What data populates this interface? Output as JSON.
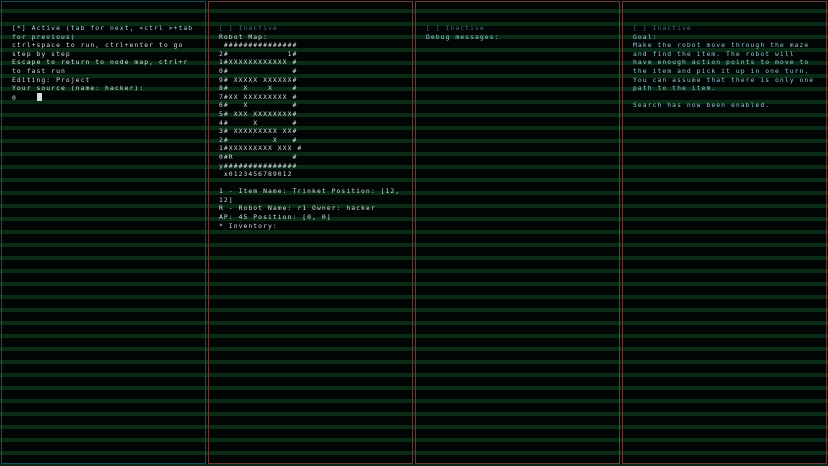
{
  "panels": {
    "editor": {
      "header": "[*] Active (tab for next, <ctrl >+tab for previous)",
      "lines": [
        "ctrl+space to run, ctrl+enter to go step by step",
        "Escape to return to node map, ctrl+r to fast run",
        "Editing: Project",
        "Your source (name: hacker):"
      ],
      "prompt": "0    "
    },
    "map": {
      "header": "[ ] Inactive",
      "title": "Robot Map:",
      "grid": [
        " ###############",
        "2#            1#",
        "1#XXXXXXXXXXXX #",
        "0#             #",
        "9# XXXXX XXXXXX#",
        "8#   X    X    #",
        "7#XX XXXXXXXXX #",
        "6#   X         #",
        "5# XXX XXXXXXXX#",
        "4#     X       #",
        "3# XXXXXXXXX XX#",
        "2#         X   #",
        "1#XXXXXXXXX XXX #",
        "0#R            #",
        "y###############",
        " x0123456789012"
      ],
      "legend": [
        "1 - Item Name: Trinket Position: [12, 12]",
        "R - Robot Name: r1 Owner: hacker",
        "AP: 45 Position: [0, 0]",
        "* Inventory:"
      ]
    },
    "debug": {
      "header": "[ ] Inactive",
      "title": "Debug messages:"
    },
    "goal": {
      "header": "[ ] Inactive",
      "title": "Goal:",
      "text": "Make the robot move through the maze and find the item. The robot will have enough action points to move to the item and pick it up in one turn. You can assume that there is only one path to the item.",
      "notice": "Search has now been enabled."
    }
  }
}
